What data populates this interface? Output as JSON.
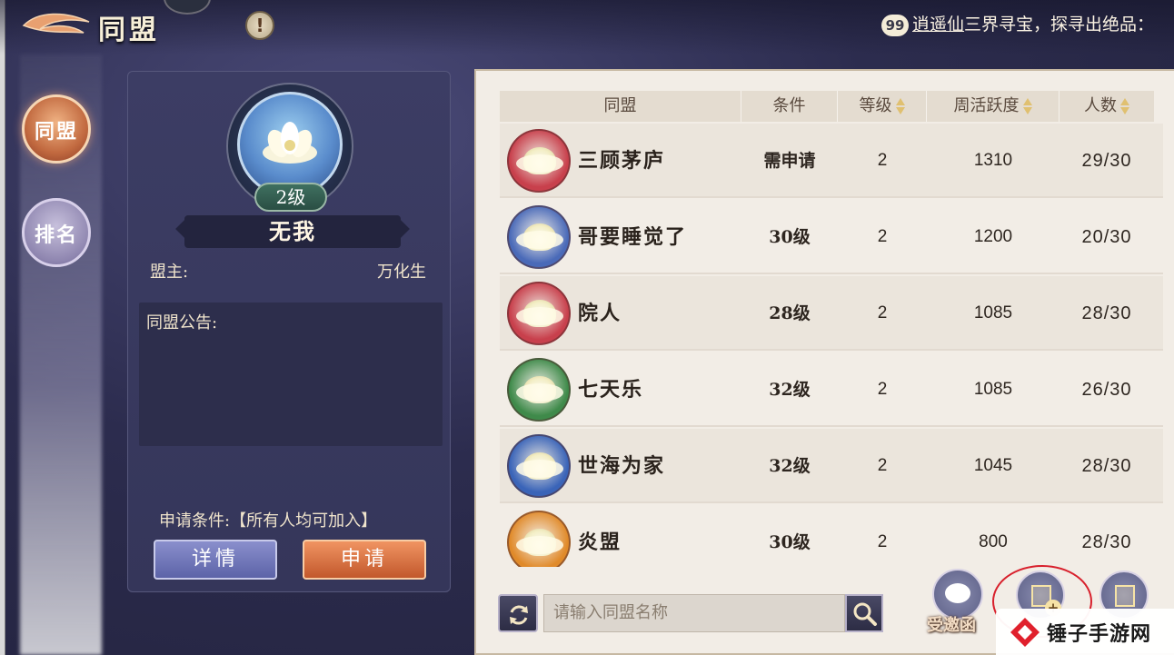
{
  "header": {
    "title": "同盟",
    "info_icon": "exclamation-icon",
    "marquee": {
      "badge": "99",
      "link": "逍遥仙",
      "text": "三界寻宝，探寻出绝品："
    }
  },
  "nav": {
    "items": [
      {
        "label": "同盟",
        "active": true
      },
      {
        "label": "排名",
        "active": false
      }
    ]
  },
  "alliance_detail": {
    "level": "2级",
    "name": "无我",
    "leader_label": "盟主:",
    "leader_value": "万化生",
    "notice_label": "同盟公告:",
    "condition": "申请条件:【所有人均可加入】",
    "detail_button": "详情",
    "apply_button": "申请"
  },
  "table": {
    "headers": [
      "同盟",
      "条件",
      "等级",
      "周活跃度",
      "人数"
    ],
    "rows": [
      {
        "name": "三顾茅庐",
        "condition": "需申请",
        "level": "2",
        "activity": "1310",
        "members": "29/30",
        "emblem_color": "#c8404c"
      },
      {
        "name": "哥要睡觉了",
        "condition": "30级",
        "level": "2",
        "activity": "1200",
        "members": "20/30",
        "emblem_color": "#4a6ab8"
      },
      {
        "name": "院人",
        "condition": "28级",
        "level": "2",
        "activity": "1085",
        "members": "28/30",
        "emblem_color": "#c8404c"
      },
      {
        "name": "七天乐",
        "condition": "32级",
        "level": "2",
        "activity": "1085",
        "members": "26/30",
        "emblem_color": "#3f8a4a"
      },
      {
        "name": "世海为家",
        "condition": "32级",
        "level": "2",
        "activity": "1045",
        "members": "28/30",
        "emblem_color": "#3a64b8"
      },
      {
        "name": "炎盟",
        "condition": "30级",
        "level": "2",
        "activity": "800",
        "members": "28/30",
        "emblem_color": "#e08a2a"
      }
    ]
  },
  "search": {
    "placeholder": "请输入同盟名称"
  },
  "actions": {
    "invite_label": "受邀函"
  },
  "watermark": "锤子手游网"
}
